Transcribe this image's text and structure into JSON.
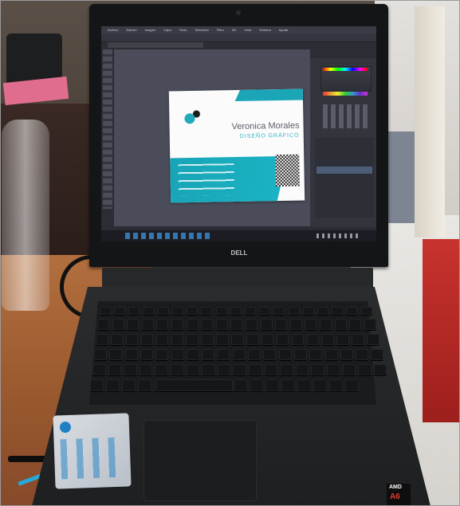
{
  "photo": {
    "laptop_brand": "DELL",
    "processor_brand": "AMD",
    "processor_model": "A6"
  },
  "screen": {
    "app_menu": [
      "Archivo",
      "Edición",
      "Imagen",
      "Capa",
      "Texto",
      "Selección",
      "Filtro",
      "3D",
      "Vista",
      "Ventana",
      "Ayuda"
    ],
    "card": {
      "name": "Veronica Morales",
      "title": "DISEÑO GRÁFICO"
    }
  },
  "colors": {
    "card_teal": "#1aa6b7",
    "ps_bg": "#2b2d35",
    "canvas_bg": "#4a4c5a",
    "taskbar": "#1c1d24",
    "laptop_body": "#222426",
    "screen_bezel": "#141517"
  }
}
